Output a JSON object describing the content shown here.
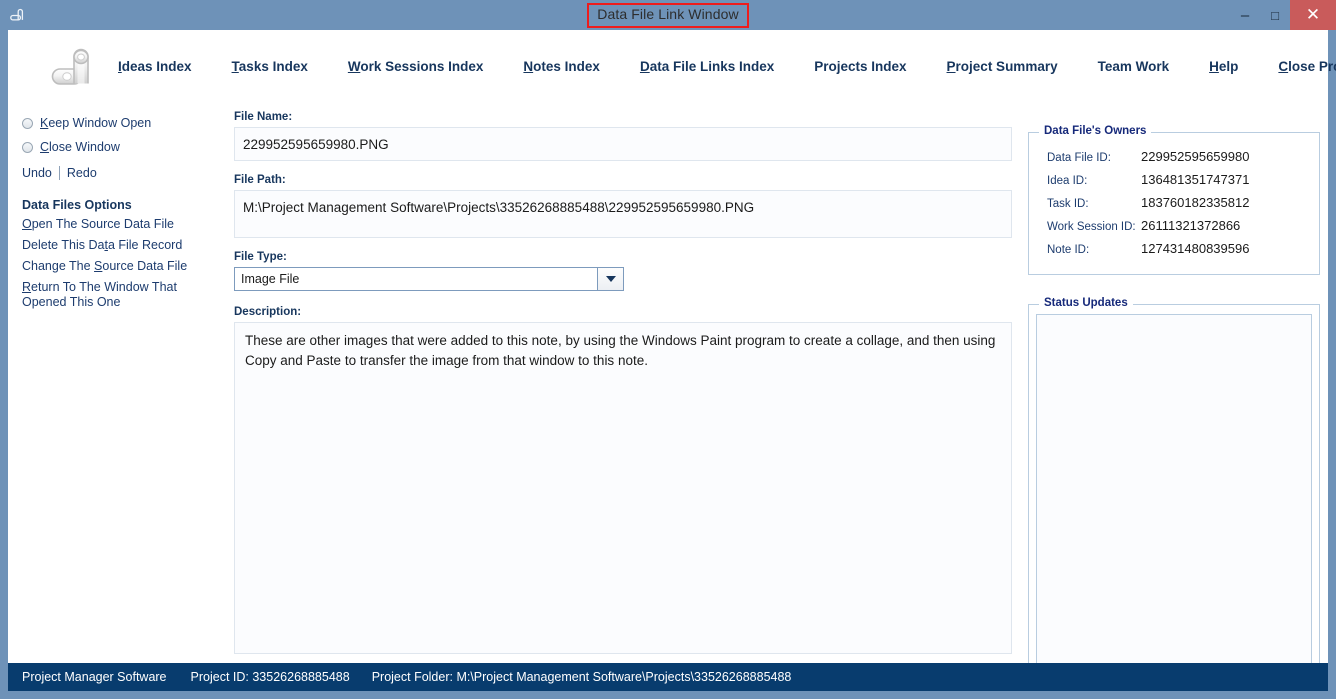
{
  "window": {
    "title": "Data File Link Window",
    "title_highlight_color": "#ee1c1c",
    "titlebar_color": "#6e92b8",
    "icon": "app-logo-icon",
    "minimize_label": "–",
    "maximize_label": "□",
    "close_label": "✕"
  },
  "nav": {
    "logo_name": "app-logo-icon",
    "items": [
      {
        "acc": "I",
        "rest": "deas Index",
        "name": "nav-ideas-index"
      },
      {
        "acc": "T",
        "rest": "asks Index",
        "name": "nav-tasks-index"
      },
      {
        "acc": "W",
        "rest": "ork Sessions Index",
        "name": "nav-work-sessions-index"
      },
      {
        "acc": "N",
        "rest": "otes Index",
        "name": "nav-notes-index"
      },
      {
        "acc": "D",
        "rest": "ata File Links Index",
        "name": "nav-data-file-links-index"
      },
      {
        "acc": "",
        "rest": "Projects Index",
        "name": "nav-projects-index"
      },
      {
        "acc": "P",
        "rest": "roject Summary",
        "name": "nav-project-summary"
      },
      {
        "acc": "",
        "rest": "Team Work",
        "name": "nav-team-work"
      },
      {
        "acc": "H",
        "rest": "elp",
        "name": "nav-help"
      },
      {
        "acc": "C",
        "rest": "lose Program",
        "name": "nav-close-program"
      }
    ]
  },
  "sidebar": {
    "radios": [
      {
        "acc": "K",
        "rest": "eep Window Open",
        "selected": false
      },
      {
        "acc": "C",
        "rest": "lose Window",
        "selected": false
      }
    ],
    "undo_label": "Undo",
    "redo_label": "Redo",
    "options_title": "Data Files Options",
    "options": [
      {
        "acc": "O",
        "rest": "pen The Source Data File"
      },
      {
        "acc": "",
        "rest": "Delete This Data File Record"
      },
      {
        "acc": "",
        "rest": "Change The Source Data File"
      },
      {
        "acc": "R",
        "rest": "eturn To The Window That Opened This One"
      }
    ]
  },
  "form": {
    "file_name_label": "File Name:",
    "file_name_value": "229952595659980.PNG",
    "file_path_label": "File Path:",
    "file_path_value": "M:\\Project Management Software\\Projects\\33526268885488\\229952595659980.PNG",
    "file_type_label": "File Type:",
    "file_type_value": "Image File",
    "file_type_options": [
      "Image File"
    ],
    "description_label": "Description:",
    "description_value": "These are other images that were added to this note, by using the Windows Paint program to create a collage, and then using Copy and Paste to transfer the image from that window to this note."
  },
  "owners": {
    "legend": "Data File's Owners",
    "rows": [
      {
        "key": "Data File ID:",
        "value": "229952595659980"
      },
      {
        "key": "Idea ID:",
        "value": "136481351747371"
      },
      {
        "key": "Task ID:",
        "value": "183760182335812"
      },
      {
        "key": "Work Session ID:",
        "value": "26111321372866"
      },
      {
        "key": "Note ID:",
        "value": "127431480839596"
      }
    ]
  },
  "status_updates": {
    "legend": "Status Updates",
    "content": ""
  },
  "statusbar": {
    "app_name": "Project Manager Software",
    "project_id_label": "Project ID:",
    "project_id_value": "33526268885488",
    "project_folder_label": "Project Folder:",
    "project_folder_value": "M:\\Project Management Software\\Projects\\33526268885488",
    "background_color": "#083c6e"
  }
}
